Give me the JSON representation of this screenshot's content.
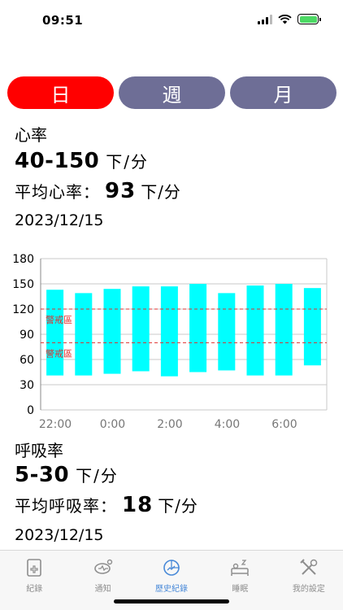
{
  "status": {
    "time": "09:51"
  },
  "tabs": [
    {
      "label": "日",
      "active": true
    },
    {
      "label": "週",
      "active": false
    },
    {
      "label": "月",
      "active": false
    }
  ],
  "heart": {
    "title": "心率",
    "range": "40-150",
    "unit": "下/分",
    "avg_label": "平均心率：",
    "avg_value": "93",
    "avg_unit": "下/分",
    "date": "2023/12/15"
  },
  "chart_data": {
    "type": "bar",
    "title": "",
    "xlabel": "",
    "ylabel": "",
    "ylim": [
      0,
      180
    ],
    "yticks": [
      "0",
      "30",
      "60",
      "90",
      "120",
      "150",
      "180"
    ],
    "xticks": [
      "22:00",
      "0:00",
      "2:00",
      "4:00",
      "6:00"
    ],
    "grid": true,
    "bar_color": "#00ffff",
    "series": [
      {
        "values": [
          [
            41,
            143
          ],
          [
            41,
            139
          ],
          [
            43,
            144
          ],
          [
            46,
            147
          ],
          [
            40,
            147
          ],
          [
            45,
            150
          ],
          [
            47,
            139
          ],
          [
            41,
            148
          ],
          [
            41,
            150
          ],
          [
            53,
            145
          ]
        ]
      }
    ],
    "warning_lines": [
      {
        "value": 120,
        "label": "警戒區",
        "color": "#e0312f"
      },
      {
        "value": 80,
        "label": "警戒區",
        "color": "#e0312f"
      }
    ]
  },
  "resp": {
    "title": "呼吸率",
    "range": "5-30",
    "unit": "下/分",
    "avg_label": "平均呼吸率：",
    "avg_value": "18",
    "avg_unit": "下/分",
    "date": "2023/12/15"
  },
  "tabbar": {
    "items": [
      {
        "label": "紀錄",
        "icon": "record-icon"
      },
      {
        "label": "通知",
        "icon": "notification-icon"
      },
      {
        "label": "歷史紀錄",
        "icon": "history-icon",
        "active": true
      },
      {
        "label": "睡眠",
        "icon": "sleep-icon"
      },
      {
        "label": "我的設定",
        "icon": "settings-icon"
      }
    ]
  }
}
